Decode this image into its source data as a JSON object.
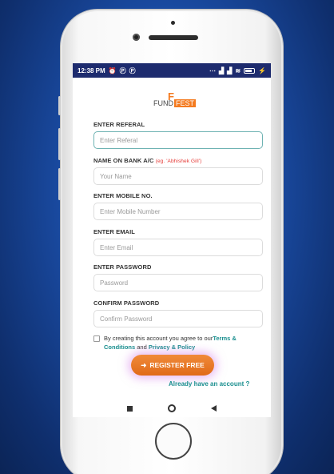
{
  "status_bar": {
    "time": "12:38 PM",
    "left_icons": [
      "alarm-icon",
      "p-icon",
      "p-icon"
    ],
    "right_icons": [
      "network-icon",
      "signal-icon",
      "signal-icon",
      "wifi-icon",
      "battery-icon",
      "charging-icon"
    ]
  },
  "brand": {
    "logo_mark": "F",
    "name_part1": "FUND",
    "name_part2": "FEST",
    "accent_color": "#f47b20",
    "bar_color": "#1d2b6e"
  },
  "form": {
    "referal": {
      "label": "ENTER REFERAL",
      "placeholder": "Enter Referal"
    },
    "name": {
      "label": "NAME ON BANK A/C",
      "hint": "(eg. 'Abhishek Gill')",
      "placeholder": "Your Name"
    },
    "mobile": {
      "label": "ENTER MOBILE NO.",
      "placeholder": "Enter Mobile Number"
    },
    "email": {
      "label": "ENTER EMAIL",
      "placeholder": "Enter Email"
    },
    "password": {
      "label": "ENTER PASSWORD",
      "placeholder": "Password"
    },
    "confirm": {
      "label": "CONFIRM PASSWORD",
      "placeholder": "Confirm Password"
    }
  },
  "terms": {
    "text_before": "By creating this account you agree to our",
    "terms_link": "Terms & Conditions",
    "and": " and ",
    "privacy_link": "Privacy & Policy"
  },
  "register_button": {
    "label": "REGISTER FREE",
    "icon": "sign-in-icon",
    "color": "#e06a18"
  },
  "login_link": "Already have an account ?",
  "link_color": "#1a8f8f"
}
